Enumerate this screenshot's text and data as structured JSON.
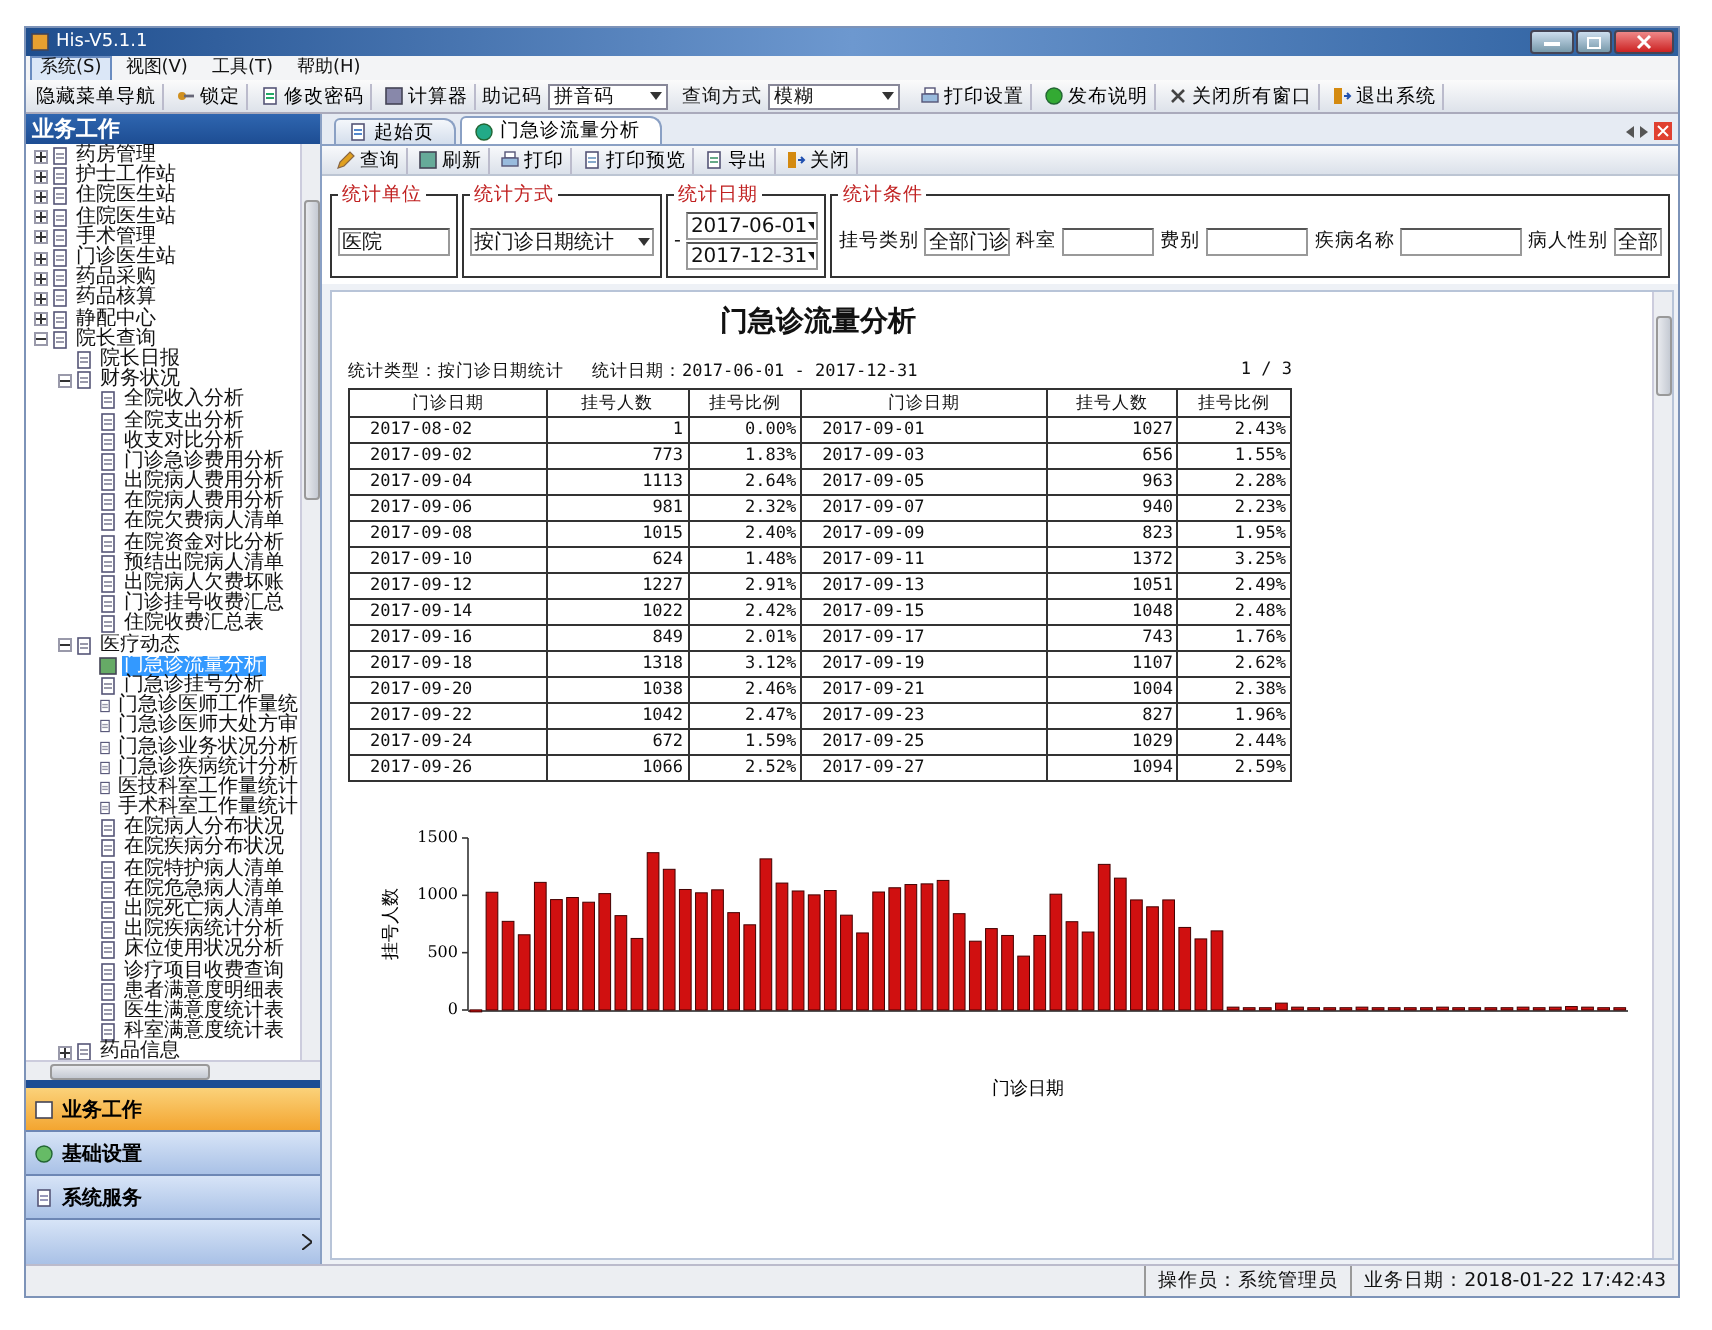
{
  "window": {
    "title": "His-V5.1.1"
  },
  "menu": [
    {
      "label": "系统(S)",
      "selected": true
    },
    {
      "label": "视图(V)",
      "selected": false
    },
    {
      "label": "工具(T)",
      "selected": false
    },
    {
      "label": "帮助(H)",
      "selected": false
    }
  ],
  "toolbar": [
    {
      "kind": "button",
      "label": "隐藏菜单导航"
    },
    {
      "kind": "button",
      "label": "锁定"
    },
    {
      "kind": "button",
      "label": "修改密码"
    },
    {
      "kind": "button",
      "label": "计算器"
    },
    {
      "kind": "select",
      "label": "助记码",
      "value": "拼音码"
    },
    {
      "kind": "select",
      "label": "查询方式",
      "value": "模糊"
    },
    {
      "kind": "button",
      "label": "打印设置"
    },
    {
      "kind": "button",
      "label": "发布说明"
    },
    {
      "kind": "button",
      "label": "关闭所有窗口"
    },
    {
      "kind": "button",
      "label": "退出系统"
    }
  ],
  "sidebar": {
    "title": "业务工作",
    "tree": [
      {
        "label": "药房管理",
        "selected": false,
        "expanded": false
      },
      {
        "label": "护士工作站",
        "selected": false,
        "expanded": false
      },
      {
        "label": "住院医生站",
        "selected": false,
        "expanded": false
      },
      {
        "label": "住院医生站",
        "selected": false,
        "expanded": false
      },
      {
        "label": "手术管理",
        "selected": false,
        "expanded": false
      },
      {
        "label": "门诊医生站",
        "selected": false,
        "expanded": false
      },
      {
        "label": "药品采购",
        "selected": false,
        "expanded": false
      },
      {
        "label": "药品核算",
        "selected": false,
        "expanded": false
      },
      {
        "label": "静配中心",
        "selected": false,
        "expanded": false
      },
      {
        "label": "院长查询",
        "selected": false,
        "expanded": true,
        "children": [
          {
            "label": "院长日报",
            "selected": false
          },
          {
            "label": "财务状况",
            "selected": false,
            "expanded": true,
            "children": [
              {
                "label": "全院收入分析",
                "selected": false
              },
              {
                "label": "全院支出分析",
                "selected": false
              },
              {
                "label": "收支对比分析",
                "selected": false
              },
              {
                "label": "门诊急诊费用分析",
                "selected": false
              },
              {
                "label": "出院病人费用分析",
                "selected": false
              },
              {
                "label": "在院病人费用分析",
                "selected": false
              },
              {
                "label": "在院欠费病人清单",
                "selected": false
              },
              {
                "label": "在院资金对比分析",
                "selected": false
              },
              {
                "label": "预结出院病人清单",
                "selected": false
              },
              {
                "label": "出院病人欠费坏账",
                "selected": false
              },
              {
                "label": "门诊挂号收费汇总",
                "selected": false
              },
              {
                "label": "住院收费汇总表",
                "selected": false
              }
            ]
          },
          {
            "label": "医疗动态",
            "selected": false,
            "expanded": true,
            "children": [
              {
                "label": "门急诊流量分析",
                "selected": true
              },
              {
                "label": "门急诊挂号分析",
                "selected": false
              },
              {
                "label": "门急诊医师工作量统",
                "selected": false
              },
              {
                "label": "门急诊医师大处方审",
                "selected": false
              },
              {
                "label": "门急诊业务状况分析",
                "selected": false
              },
              {
                "label": "门急诊疾病统计分析",
                "selected": false
              },
              {
                "label": "医技科室工作量统计",
                "selected": false
              },
              {
                "label": "手术科室工作量统计",
                "selected": false
              },
              {
                "label": "在院病人分布状况",
                "selected": false
              },
              {
                "label": "在院疾病分布状况",
                "selected": false
              },
              {
                "label": "在院特护病人清单",
                "selected": false
              },
              {
                "label": "在院危急病人清单",
                "selected": false
              },
              {
                "label": "出院死亡病人清单",
                "selected": false
              },
              {
                "label": "出院疾病统计分析",
                "selected": false
              },
              {
                "label": "床位使用状况分析",
                "selected": false
              },
              {
                "label": "诊疗项目收费查询",
                "selected": false
              },
              {
                "label": "患者满意度明细表",
                "selected": false
              },
              {
                "label": "医生满意度统计表",
                "selected": false
              },
              {
                "label": "科室满意度统计表",
                "selected": false
              }
            ]
          },
          {
            "label": "药品信息",
            "selected": false,
            "expanded": false
          }
        ]
      }
    ],
    "nav": [
      {
        "label": "业务工作",
        "selected": true
      },
      {
        "label": "基础设置",
        "selected": false
      },
      {
        "label": "系统服务",
        "selected": false
      }
    ]
  },
  "tabs": [
    {
      "label": "起始页",
      "selected": false
    },
    {
      "label": "门急诊流量分析",
      "selected": true
    }
  ],
  "report_toolbar": [
    "查询",
    "刷新",
    "打印",
    "打印预览",
    "导出",
    "关闭"
  ],
  "filters": {
    "unit": {
      "legend": "统计单位",
      "value": "医院"
    },
    "method": {
      "legend": "统计方式",
      "value": "按门诊日期统计"
    },
    "dates": {
      "legend": "统计日期",
      "separator": "-",
      "from": "2017-06-01",
      "to": "2017-12-31"
    },
    "conditions": {
      "legend": "统计条件",
      "fields": [
        {
          "label": "挂号类别",
          "value": "全部门诊"
        },
        {
          "label": "科室"
        },
        {
          "label": "费别"
        },
        {
          "label": "疾病名称"
        },
        {
          "label": "病人性别",
          "value": "全部"
        }
      ]
    }
  },
  "report": {
    "title": "门急诊流量分析",
    "type_label": "统计类型：按门诊日期统计",
    "date_label": "统计日期：2017-06-01 - 2017-12-31",
    "page": "1 / 3",
    "columns": [
      "门诊日期",
      "挂号人数",
      "挂号比例",
      "门诊日期",
      "挂号人数",
      "挂号比例"
    ],
    "rows": [
      [
        "2017-08-02",
        "1",
        "0.00%",
        "2017-09-01",
        "1027",
        "2.43%"
      ],
      [
        "2017-09-02",
        "773",
        "1.83%",
        "2017-09-03",
        "656",
        "1.55%"
      ],
      [
        "2017-09-04",
        "1113",
        "2.64%",
        "2017-09-05",
        "963",
        "2.28%"
      ],
      [
        "2017-09-06",
        "981",
        "2.32%",
        "2017-09-07",
        "940",
        "2.23%"
      ],
      [
        "2017-09-08",
        "1015",
        "2.40%",
        "2017-09-09",
        "823",
        "1.95%"
      ],
      [
        "2017-09-10",
        "624",
        "1.48%",
        "2017-09-11",
        "1372",
        "3.25%"
      ],
      [
        "2017-09-12",
        "1227",
        "2.91%",
        "2017-09-13",
        "1051",
        "2.49%"
      ],
      [
        "2017-09-14",
        "1022",
        "2.42%",
        "2017-09-15",
        "1048",
        "2.48%"
      ],
      [
        "2017-09-16",
        "849",
        "2.01%",
        "2017-09-17",
        "743",
        "1.76%"
      ],
      [
        "2017-09-18",
        "1318",
        "3.12%",
        "2017-09-19",
        "1107",
        "2.62%"
      ],
      [
        "2017-09-20",
        "1038",
        "2.46%",
        "2017-09-21",
        "1004",
        "2.38%"
      ],
      [
        "2017-09-22",
        "1042",
        "2.47%",
        "2017-09-23",
        "827",
        "1.96%"
      ],
      [
        "2017-09-24",
        "672",
        "1.59%",
        "2017-09-25",
        "1029",
        "2.44%"
      ],
      [
        "2017-09-26",
        "1066",
        "2.52%",
        "2017-09-27",
        "1094",
        "2.59%"
      ]
    ],
    "chart_data": {
      "type": "bar",
      "xlabel": "门诊日期",
      "ylabel": "挂号人数",
      "ylim": [
        0,
        1500
      ],
      "yticks": [
        0,
        500,
        1000,
        1500
      ],
      "categories": [
        null,
        null,
        null,
        null,
        null,
        null,
        null,
        null,
        null,
        null,
        null,
        null,
        null,
        null,
        null,
        null,
        null,
        null,
        null,
        null,
        null,
        null,
        null,
        null,
        null,
        null,
        null,
        null,
        null,
        null,
        null,
        null,
        null,
        null,
        null,
        null,
        null,
        null,
        null,
        null,
        null,
        null,
        null,
        null,
        null,
        null,
        null,
        null,
        null,
        null,
        null,
        null,
        null,
        null,
        null,
        null,
        null,
        null,
        null,
        null,
        null,
        null,
        null,
        null,
        null,
        null,
        null,
        null,
        null,
        null,
        null,
        null
      ],
      "values": [
        1,
        1027,
        773,
        656,
        1113,
        963,
        981,
        940,
        1015,
        823,
        624,
        1372,
        1227,
        1051,
        1022,
        1048,
        849,
        743,
        1318,
        1107,
        1038,
        1004,
        1042,
        827,
        672,
        1029,
        1066,
        1094,
        1100,
        1130,
        840,
        600,
        710,
        650,
        470,
        650,
        1010,
        770,
        680,
        1270,
        1150,
        960,
        900,
        960,
        720,
        620,
        690,
        25,
        20,
        20,
        60,
        25,
        20,
        20,
        20,
        25,
        20,
        20,
        20,
        20,
        25,
        20,
        20,
        20,
        20,
        25,
        20,
        25,
        30,
        25,
        20,
        20
      ]
    }
  },
  "status_bar": {
    "operator": "操作员：系统管理员",
    "date": "业务日期：2018-01-22  17:42:43"
  }
}
